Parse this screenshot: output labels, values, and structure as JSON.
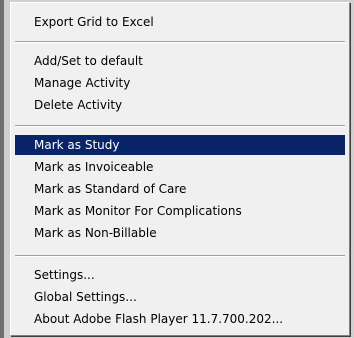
{
  "context_menu": {
    "items": [
      {
        "label": "Export Grid to Excel"
      },
      {
        "label": "Add/Set to default"
      },
      {
        "label": "Manage Activity"
      },
      {
        "label": "Delete Activity"
      },
      {
        "label": "Mark as Study",
        "selected": true
      },
      {
        "label": "Mark as Invoiceable"
      },
      {
        "label": "Mark as Standard of Care"
      },
      {
        "label": "Mark as Monitor For Complications"
      },
      {
        "label": "Mark as Non-Billable"
      },
      {
        "label": "Settings..."
      },
      {
        "label": "Global Settings..."
      },
      {
        "label": "About Adobe Flash Player 11.7.700.202..."
      }
    ]
  },
  "colors": {
    "menu_background": "#f0f0f0",
    "highlight": "#0a246a",
    "highlight_text": "#ffffff"
  }
}
